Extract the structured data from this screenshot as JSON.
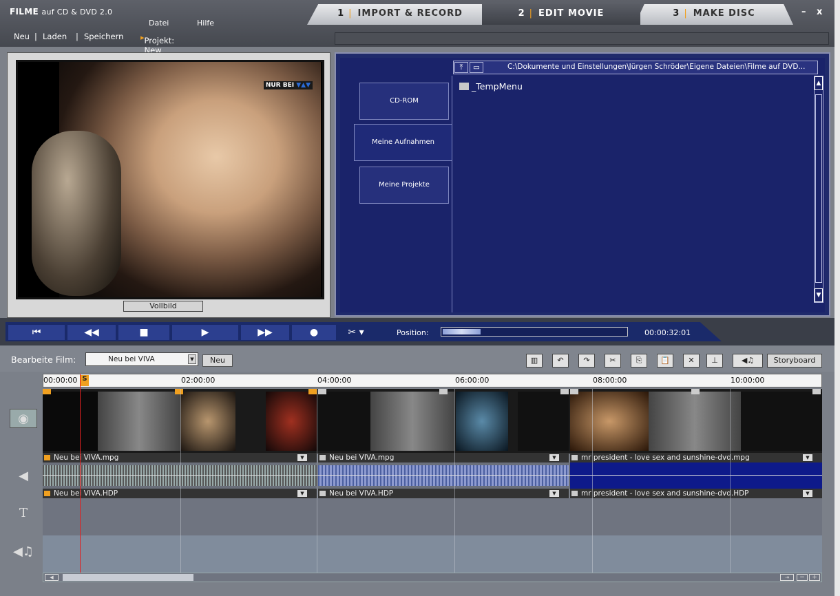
{
  "app": {
    "title_bold": "FILME",
    "title_rest": "auf CD & DVD 2.0",
    "menu": [
      "Datei",
      "Hilfe"
    ],
    "file_actions": [
      "Neu",
      "Laden",
      "Speichern"
    ],
    "project_label": "Projekt: New"
  },
  "tabs": [
    {
      "num": "1",
      "label": "IMPORT & RECORD"
    },
    {
      "num": "2",
      "label": "EDIT MOVIE"
    },
    {
      "num": "3",
      "label": "MAKE DISC"
    }
  ],
  "window": {
    "minimize": "–",
    "close": "x"
  },
  "preview": {
    "fullscreen_label": "Vollbild",
    "logo_text": "NUR BEI"
  },
  "browser": {
    "path": "C:\\Dokumente und Einstellungen\\Jürgen Schröder\\Eigene Dateien\\Filme auf DVD...",
    "nav": [
      "CD-ROM",
      "Meine Aufnahmen",
      "Meine Projekte"
    ],
    "files": [
      "_TempMenu"
    ]
  },
  "transport": {
    "position_label": "Position:",
    "time": "00:00:32:01",
    "position_fraction": 0.08
  },
  "editor": {
    "label": "Bearbeite Film:",
    "movie": "Neu bei VIVA",
    "new_button": "Neu",
    "storyboard_button": "Storyboard",
    "ruler": [
      "00:00:00",
      "02:00:00",
      "04:00:00",
      "06:00:00",
      "08:00:00",
      "10:00:00"
    ],
    "marker_s": "S",
    "video_clips": [
      "Neu bei VIVA.mpg",
      "Neu bei VIVA.mpg",
      "mr president - love sex and sunshine-dvd.mpg"
    ],
    "audio_clips": [
      "Neu bei VIVA.HDP",
      "Neu bei VIVA.HDP",
      "mr president - love sex and sunshine-dvd.HDP"
    ]
  },
  "colors": {
    "accent": "#f0a020",
    "browser_bg": "#1a236a",
    "playhead": "#e02020"
  }
}
